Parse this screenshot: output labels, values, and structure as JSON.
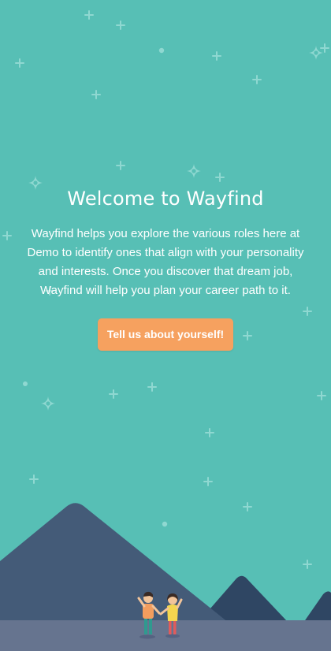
{
  "welcome": {
    "title": "Welcome to Wayfind",
    "description": "Wayfind helps you explore the various roles here at Demo to identify ones that align with your personality and interests. Once you discover that dream job, Wayfind will help you plan your career path to it.",
    "cta_label": "Tell us about yourself!"
  },
  "colors": {
    "background": "#57bfb5",
    "accent": "#f6a15f",
    "mountain_front": "#445b78",
    "mountain_back": "#2f4663",
    "ground": "#66748f"
  },
  "illustration": {
    "icons": [
      "sparkle-icon",
      "plus-star-icon",
      "dot-star-icon",
      "mountain-icon",
      "person-icon"
    ]
  }
}
